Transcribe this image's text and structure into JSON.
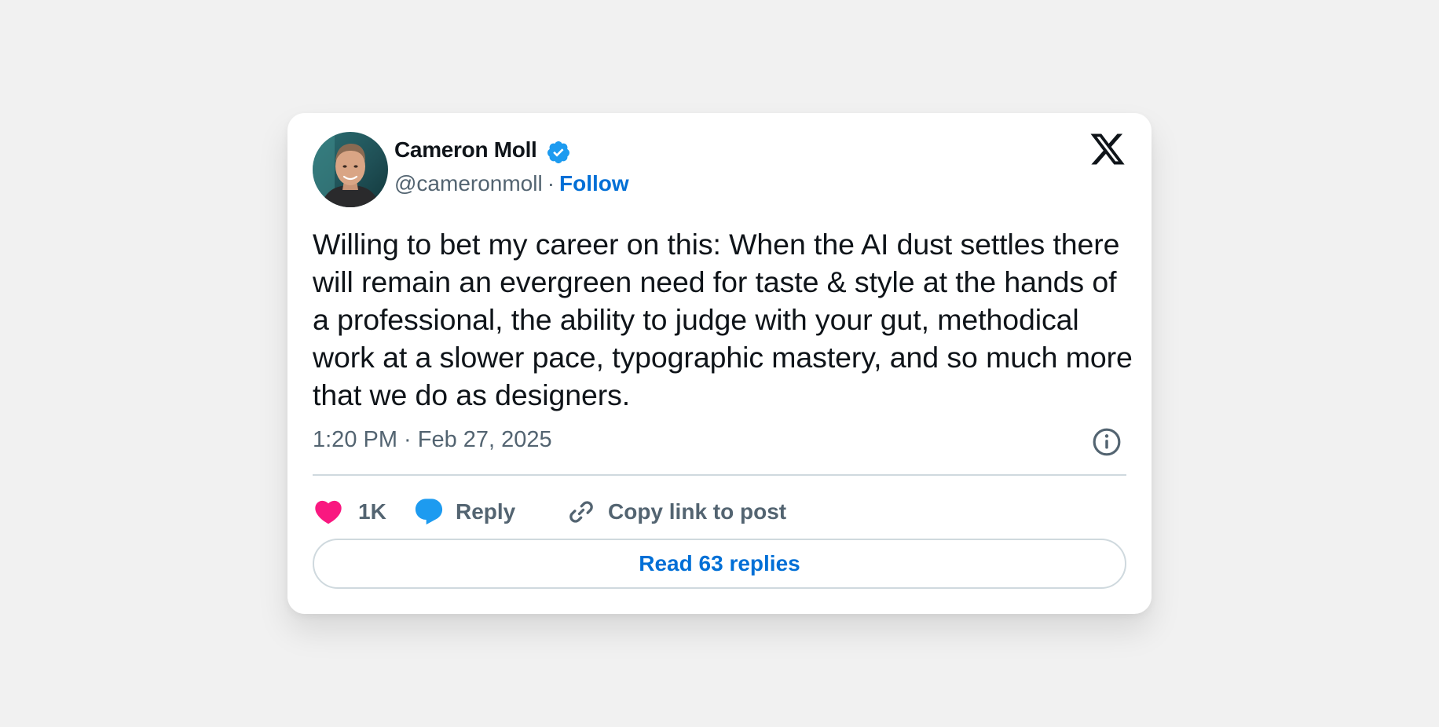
{
  "tweet": {
    "author_name": "Cameron Moll",
    "handle": "@cameronmoll",
    "separator": "·",
    "follow_label": "Follow",
    "text": "Willing to bet my career on this: When the AI dust settles there will remain an evergreen need for taste & style at the hands of a professional, the ability to judge with your gut, methodical work at a slower pace, typographic mastery, and so much more that we do as designers.",
    "timestamp": "1:20 PM · Feb 27, 2025",
    "likes": "1K",
    "reply_label": "Reply",
    "copy_link_label": "Copy link to post",
    "read_replies_label": "Read 63 replies"
  },
  "icons": {
    "brand": "x-logo-icon",
    "verified": "verified-badge-icon",
    "info": "info-icon",
    "like": "heart-icon",
    "reply": "speech-bubble-icon",
    "copy_link": "link-icon"
  },
  "colors": {
    "page_background": "#f1f1f1",
    "card_background": "#ffffff",
    "text_primary": "#0f1419",
    "text_secondary": "#536471",
    "link_blue": "#006fd6",
    "verified_blue": "#1d9bf0",
    "heart_pink": "#f91880",
    "reply_blue": "#1d9bf0",
    "divider": "#cfd9de"
  }
}
